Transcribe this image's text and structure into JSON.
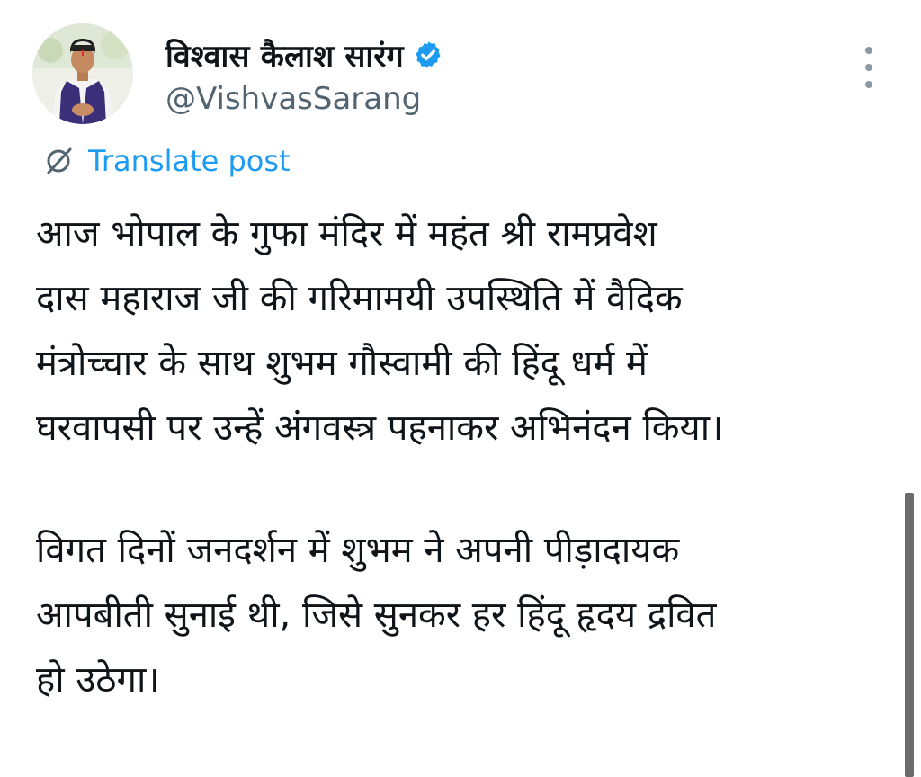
{
  "post": {
    "author": {
      "display_name": "विश्वास कैलाश सारंग",
      "handle": "@VishvasSarang",
      "verified": true,
      "avatar_icon": "profile-photo"
    },
    "menu_icon": "more-vertical-icon",
    "translate": {
      "label": "Translate post",
      "icon": "translate-icon"
    },
    "text": {
      "paragraph_1": "आज भोपाल के गुफा मंदिर में महंत श्री रामप्रवेश\nदास महाराज जी की गरिमामयी उपस्थिति में वैदिक\nमंत्रोच्चार के साथ शुभम गौस्वामी की हिंदू धर्म में\nघरवापसी पर उन्हें अंगवस्त्र पहनाकर अभिनंदन किया।",
      "paragraph_2": "विगत दिनों जनदर्शन में शुभम ने अपनी पीड़ादायक\nआपबीती सुनाई थी, जिसे सुनकर हर हिंदू हृदय द्रवित\nहो उठेगा।"
    }
  },
  "colors": {
    "text": "#0f1419",
    "secondary": "#536471",
    "link": "#1d9bf0",
    "verified_badge": "#1d9bf0"
  }
}
